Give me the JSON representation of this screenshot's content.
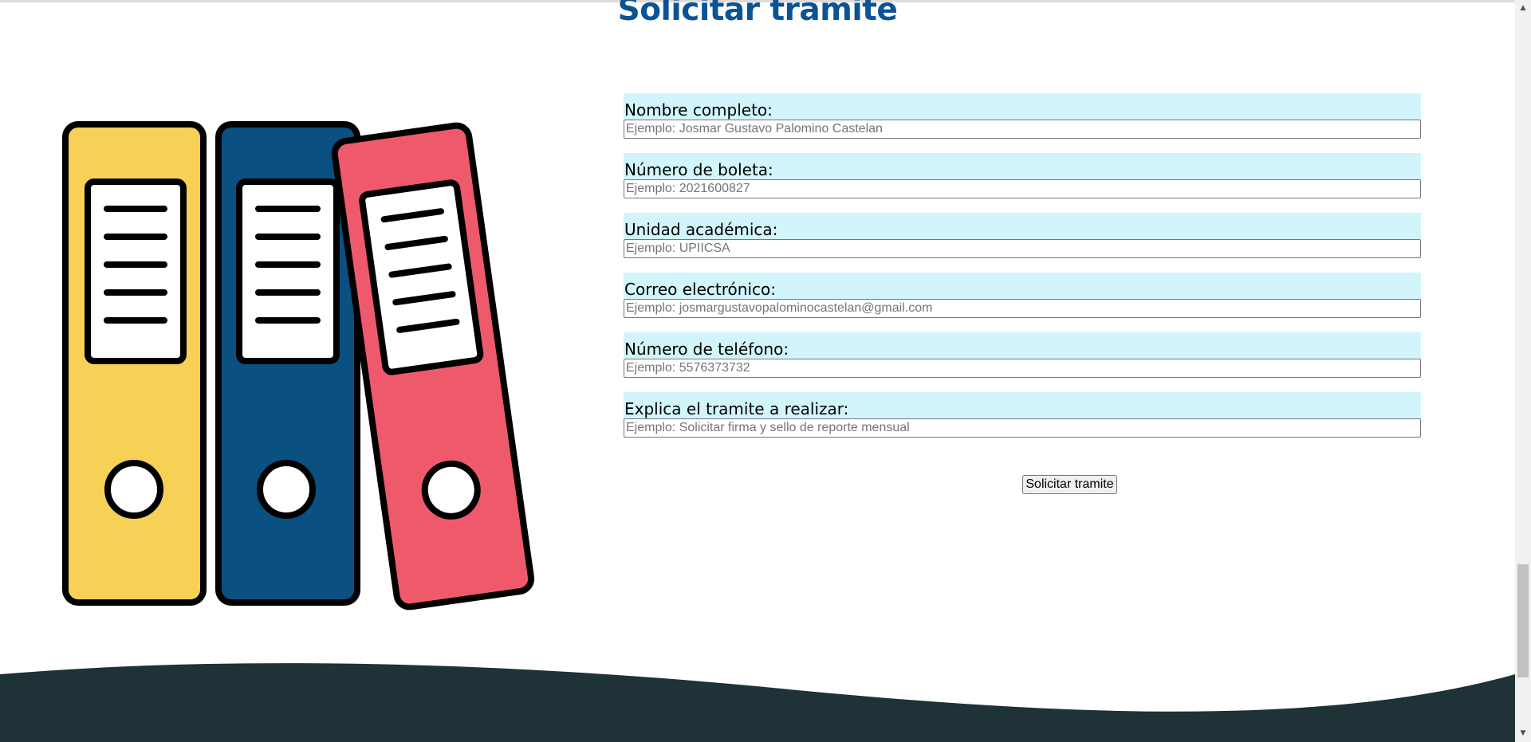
{
  "page": {
    "title": "Solicitar tramite"
  },
  "illustration": {
    "icon": "binders-illustration",
    "colors": {
      "yellow": "#f6d155",
      "blue": "#0a5080",
      "red": "#ef596c",
      "outline": "#000000"
    }
  },
  "form": {
    "fields": [
      {
        "label": "Nombre completo:",
        "placeholder": "Ejemplo: Josmar Gustavo Palomino Castelan",
        "value": ""
      },
      {
        "label": "Número de boleta:",
        "placeholder": "Ejemplo: 2021600827",
        "value": ""
      },
      {
        "label": "Unidad académica:",
        "placeholder": "Ejemplo: UPIICSA",
        "value": ""
      },
      {
        "label": "Correo electrónico:",
        "placeholder": "Ejemplo: josmargustavopalominocastelan@gmail.com",
        "value": ""
      },
      {
        "label": "Número de teléfono:",
        "placeholder": "Ejemplo: 5576373732",
        "value": ""
      },
      {
        "label": "Explica el tramite a realizar:",
        "placeholder": "Ejemplo: Solicitar firma y sello de reporte mensual",
        "value": ""
      }
    ],
    "submit_label": "Solicitar tramite"
  },
  "theme": {
    "title_color": "#0b5394",
    "label_background": "#d1f5fa",
    "footer_color": "#1e3237"
  }
}
